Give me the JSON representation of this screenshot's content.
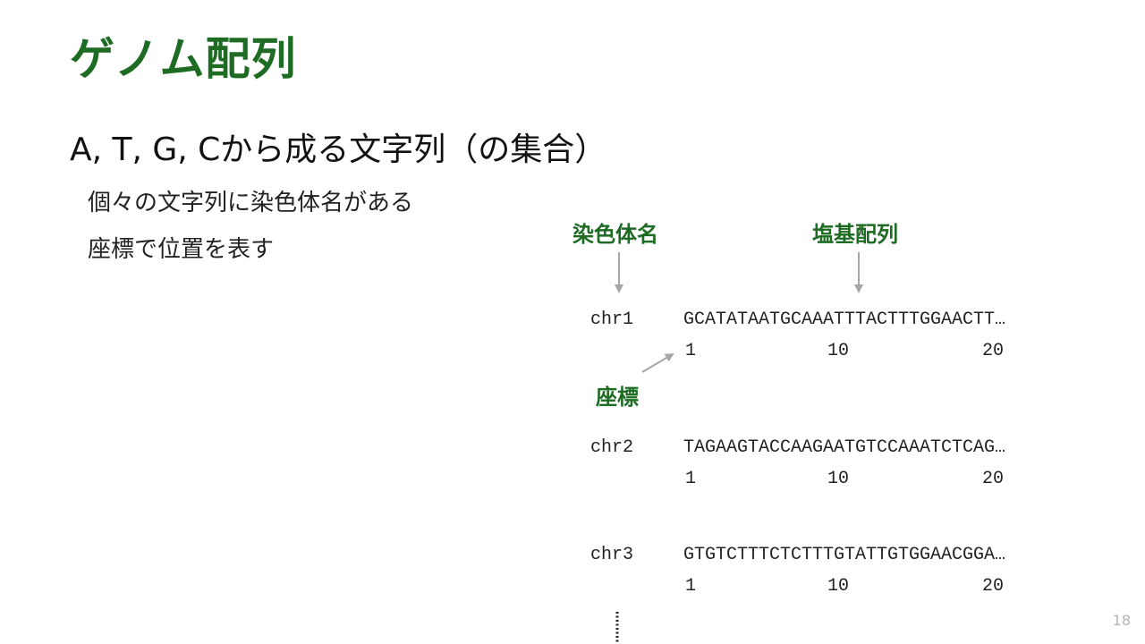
{
  "slide": {
    "title": "ゲノム配列",
    "subtitle": "A, T, G, Cから成る文字列（の集合）",
    "bullets": [
      "個々の文字列に染色体名がある",
      "座標で位置を表す"
    ],
    "page_number": "18"
  },
  "diagram": {
    "labels": {
      "chromosome": "染色体名",
      "sequence": "塩基配列",
      "coordinate": "座標"
    },
    "rows": [
      {
        "chrom": "chr1",
        "seq": "GCATATAATGCAAATTTACTTTGGAACTT…",
        "ticks": [
          "1",
          "10",
          "20"
        ]
      },
      {
        "chrom": "chr2",
        "seq": "TAGAAGTACCAAGAATGTCCAAATCTCAG…",
        "ticks": [
          "1",
          "10",
          "20"
        ]
      },
      {
        "chrom": "chr3",
        "seq": "GTGTCTTTCTCTTTGTATTGTGGAACGGA…",
        "ticks": [
          "1",
          "10",
          "20"
        ]
      }
    ]
  },
  "colors": {
    "accent_green": "#1e6b23",
    "arrow_gray": "#a6a6a6",
    "text": "#111111"
  }
}
